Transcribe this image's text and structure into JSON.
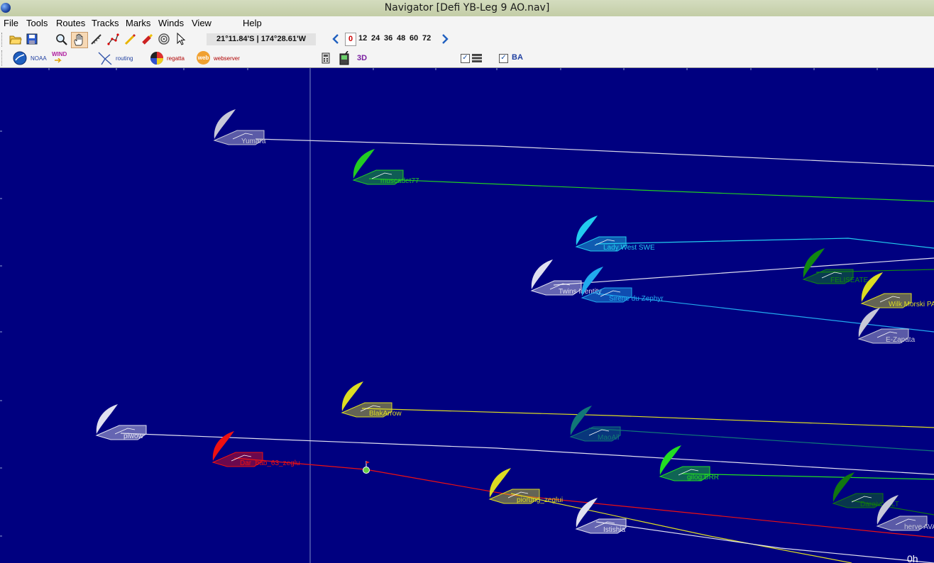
{
  "window": {
    "title": "Navigator [Defi YB-Leg 9 AO.nav]"
  },
  "menu": [
    "File",
    "Tools",
    "Routes",
    "Tracks",
    "Marks",
    "Winds",
    "View",
    "Help"
  ],
  "toolbar": {
    "position": "21°11.84'S | 174°28.61'W",
    "hours_selected": "0",
    "hours": [
      "12",
      "24",
      "36",
      "48",
      "60",
      "72"
    ]
  },
  "toolbar2": {
    "noaa": "NOAA",
    "wind": "WIND",
    "routing": "routing",
    "regatta": "regatta",
    "webserver": "webserver",
    "web": "web",
    "view3d": "3D",
    "ba": "BA",
    "check1": true,
    "check2": true
  },
  "map": {
    "background": "#000080",
    "time_label": "0h",
    "boats": [
      {
        "name": "Yumara",
        "color": "#c8c8d8"
      },
      {
        "name": "muscadet77",
        "color": "#22cc22"
      },
      {
        "name": "Lady West SWE",
        "color": "#22ccee"
      },
      {
        "name": "FELISEATE",
        "color": "#118811"
      },
      {
        "name": "Twins Identity",
        "color": "#e0e0f0"
      },
      {
        "name": "Sirene du Zephyr",
        "color": "#22aaee"
      },
      {
        "name": "Wilk Morski PAi",
        "color": "#dddd22"
      },
      {
        "name": "E-Zapata",
        "color": "#c8c8d8"
      },
      {
        "name": "BlakArrow",
        "color": "#dddd22"
      },
      {
        "name": "piwow",
        "color": "#e0e0f0"
      },
      {
        "name": "MaoAll",
        "color": "#117777"
      },
      {
        "name": "Dar_bab_63_zeglu",
        "color": "#ee1111"
      },
      {
        "name": "gilog.BRR",
        "color": "#22dd22"
      },
      {
        "name": "piorung_zeglui",
        "color": "#dddd22"
      },
      {
        "name": "Dareivo.SLT",
        "color": "#117711"
      },
      {
        "name": "Istishia",
        "color": "#e0e0f0"
      },
      {
        "name": "herve AVA",
        "color": "#c8c8d8"
      }
    ]
  }
}
